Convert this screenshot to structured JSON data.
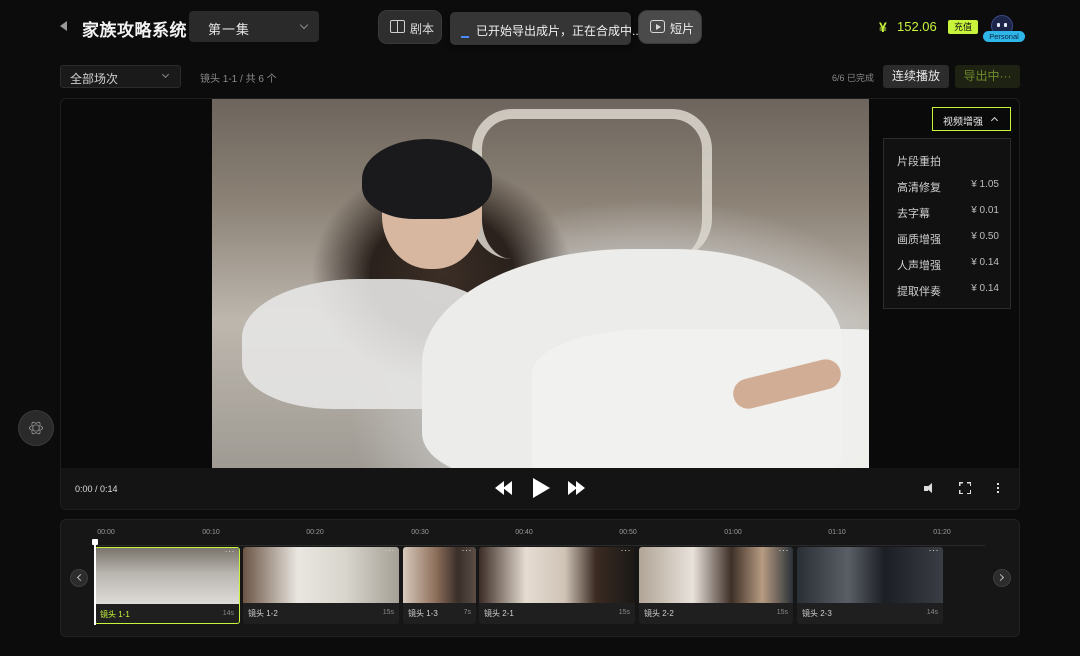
{
  "header": {
    "title": "家族攻略系统",
    "episode_selected": "第一集",
    "script_label": "剧本",
    "toast_text": "已开始导出成片，正在合成中...",
    "short_label": "短片",
    "currency_symbol": "¥",
    "balance": "152.06",
    "recharge_label": "充值",
    "personal_badge": "Personal",
    "accent_color": "#c8f53b"
  },
  "toolbar": {
    "scene_filter": "全部场次",
    "shot_info": "镜头 1-1 / 共 6 个",
    "done_status": "6/6 已完成",
    "continuous_play_label": "连续播放",
    "export_label": "导出中···"
  },
  "player": {
    "time_display": "0:00 / 0:14",
    "enhance_label": "视频增强",
    "enhance_menu": [
      {
        "name": "片段重拍",
        "price": ""
      },
      {
        "name": "高清修复",
        "price": "¥ 1.05"
      },
      {
        "name": "去字幕",
        "price": "¥ 0.01"
      },
      {
        "name": "画质增强",
        "price": "¥ 0.50"
      },
      {
        "name": "人声增强",
        "price": "¥ 0.14"
      },
      {
        "name": "提取伴奏",
        "price": "¥ 0.14"
      }
    ]
  },
  "timeline": {
    "ticks": [
      "00:00",
      "00:10",
      "00:20",
      "00:30",
      "00:40",
      "00:50",
      "01:00",
      "01:10",
      "01:20"
    ],
    "clips": [
      {
        "name": "镜头 1-1",
        "duration": "14s",
        "more": "···"
      },
      {
        "name": "镜头 1-2",
        "duration": "15s",
        "more": "···"
      },
      {
        "name": "镜头 1-3",
        "duration": "7s",
        "more": "···"
      },
      {
        "name": "镜头 2-1",
        "duration": "15s",
        "more": "···"
      },
      {
        "name": "镜头 2-2",
        "duration": "15s",
        "more": "···"
      },
      {
        "name": "镜头 2-3",
        "duration": "14s",
        "more": "···"
      }
    ]
  }
}
